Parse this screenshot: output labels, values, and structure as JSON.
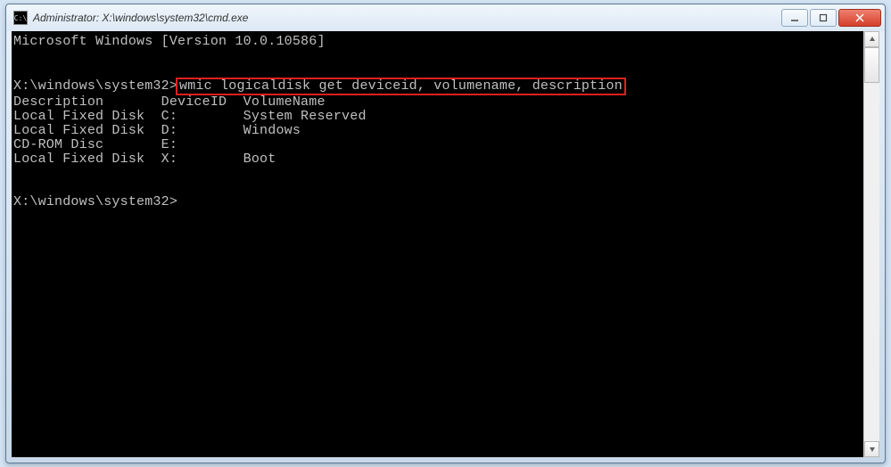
{
  "window": {
    "title": "Administrator: X:\\windows\\system32\\cmd.exe",
    "icon_label": "cmd-icon"
  },
  "console": {
    "header_line": "Microsoft Windows [Version 10.0.10586]",
    "prompt1_path": "X:\\windows\\system32>",
    "highlighted_command": "wmic logicaldisk get deviceid, volumename, description",
    "table_header": "Description       DeviceID  VolumeName",
    "rows": [
      {
        "description": "Local Fixed Disk",
        "deviceid": "C:",
        "volumename": "System Reserved"
      },
      {
        "description": "Local Fixed Disk",
        "deviceid": "D:",
        "volumename": "Windows"
      },
      {
        "description": "CD-ROM Disc",
        "deviceid": "E:",
        "volumename": ""
      },
      {
        "description": "Local Fixed Disk",
        "deviceid": "X:",
        "volumename": "Boot"
      }
    ],
    "row0": "Local Fixed Disk  C:        System Reserved",
    "row1": "Local Fixed Disk  D:        Windows",
    "row2": "CD-ROM Disc       E:",
    "row3": "Local Fixed Disk  X:        Boot",
    "prompt2": "X:\\windows\\system32>"
  }
}
